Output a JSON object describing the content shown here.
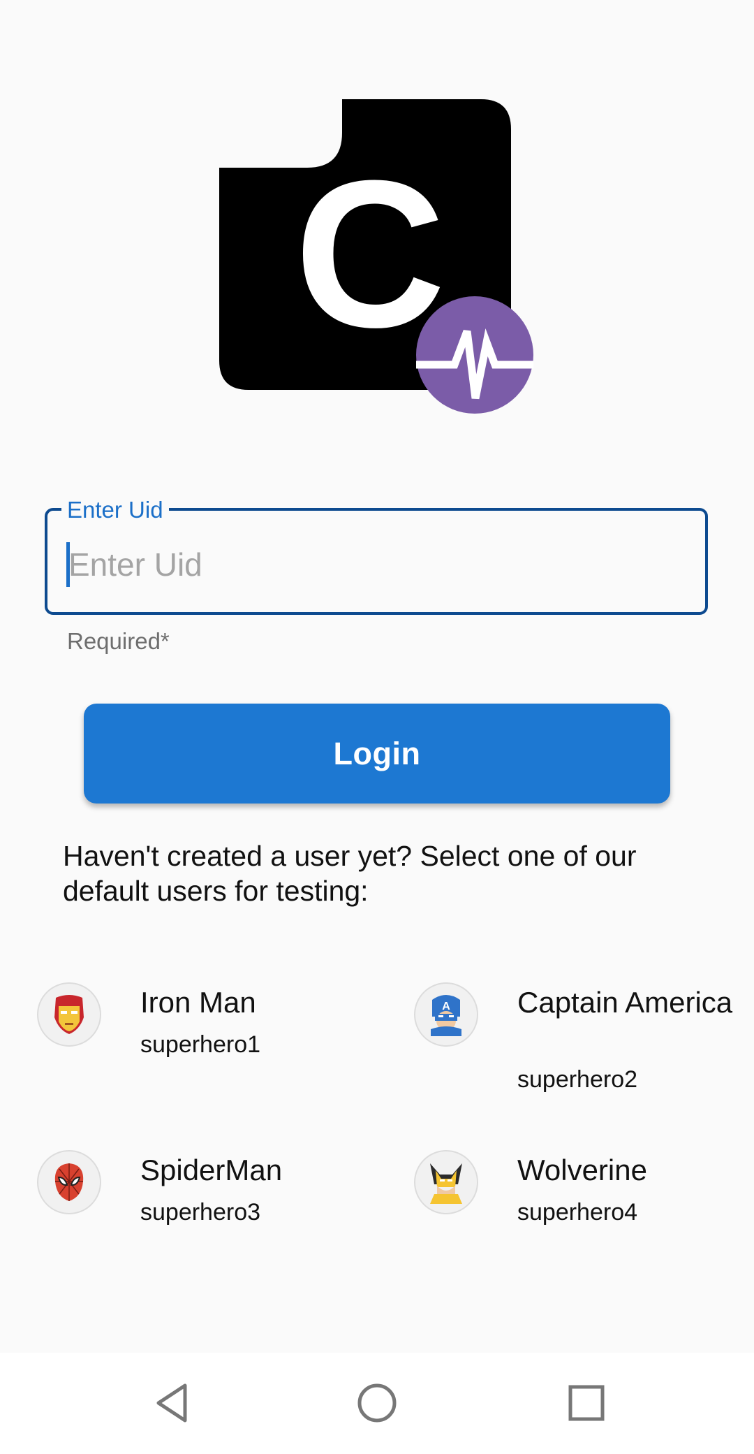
{
  "login_form": {
    "uid_label": "Enter Uid",
    "uid_placeholder": "Enter Uid",
    "uid_value": "",
    "helper_text": "Required*",
    "login_label": "Login"
  },
  "default_users_prompt": "Haven't created a user yet? Select one of our default users for testing:",
  "default_users": [
    {
      "name": "Iron Man",
      "uid": "superhero1",
      "icon": "iron-man-avatar"
    },
    {
      "name": "Captain America",
      "uid": "superhero2",
      "icon": "captain-america-avatar"
    },
    {
      "name": "SpiderMan",
      "uid": "superhero3",
      "icon": "spiderman-avatar"
    },
    {
      "name": "Wolverine",
      "uid": "superhero4",
      "icon": "wolverine-avatar"
    }
  ],
  "logo": {
    "letter": "C",
    "primary_color": "#000000",
    "badge_color": "#7b5ca8"
  },
  "colors": {
    "accent": "#1d78d2",
    "field_border": "#0d4a8f",
    "background": "#fafafa"
  },
  "navigation_bar": [
    "back-icon",
    "home-icon",
    "recents-icon"
  ]
}
